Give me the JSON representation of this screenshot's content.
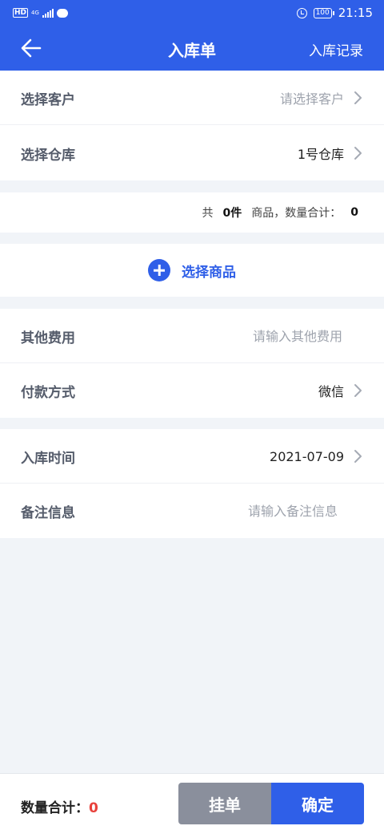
{
  "status_bar": {
    "hd": "HD",
    "network": "4G",
    "battery": "100",
    "time": "21:15"
  },
  "header": {
    "title": "入库单",
    "records_link": "入库记录"
  },
  "form": {
    "customer_label": "选择客户",
    "customer_placeholder": "请选择客户",
    "warehouse_label": "选择仓库",
    "warehouse_value": "1号仓库",
    "summary_prefix": "共",
    "summary_count": "0件",
    "summary_middle": "商品，数量合计：",
    "summary_total": "0",
    "add_goods_label": "选择商品",
    "other_fee_label": "其他费用",
    "other_fee_placeholder": "请输入其他费用",
    "payment_label": "付款方式",
    "payment_value": "微信",
    "date_label": "入库时间",
    "date_value": "2021-07-09",
    "remark_label": "备注信息",
    "remark_placeholder": "请输入备注信息"
  },
  "footer": {
    "total_label": "数量合计：",
    "total_value": "0",
    "hold_button": "挂单",
    "confirm_button": "确定"
  },
  "colors": {
    "primary": "#2f5fe8",
    "hold_button": "#8a8f9c",
    "total_value": "#e8413b",
    "background": "#f1f4f8"
  },
  "icons": [
    "arrow-left-icon",
    "chevron-right-icon",
    "plus-circle-icon",
    "alarm-icon",
    "battery-icon",
    "signal-icon",
    "message-icon"
  ]
}
